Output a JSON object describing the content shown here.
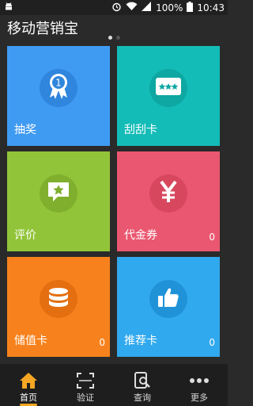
{
  "status_bar": {
    "battery_percent": "100%",
    "time": "10:43",
    "icons": [
      "android-icon",
      "alarm-icon",
      "wifi-icon",
      "signal-icon",
      "battery-icon"
    ]
  },
  "app": {
    "title": "移动营销宝"
  },
  "pager": {
    "total": 2,
    "current": 1
  },
  "tiles": [
    {
      "label": "抽奖",
      "count": "",
      "color": "#3f9bf2",
      "circle": "#2f86dc",
      "icon": "award-icon"
    },
    {
      "label": "刮刮卡",
      "count": "",
      "color": "#14bcb7",
      "circle": "#0ea7a2",
      "icon": "scratch-card-icon"
    },
    {
      "label": "评价",
      "count": "",
      "color": "#92c439",
      "circle": "#7faf2d",
      "icon": "review-star-icon"
    },
    {
      "label": "代金券",
      "count": "0",
      "color": "#ea5770",
      "circle": "#d7485f",
      "icon": "yen-coupon-icon"
    },
    {
      "label": "储值卡",
      "count": "0",
      "color": "#f7821d",
      "circle": "#e36f10",
      "icon": "coin-stack-icon"
    },
    {
      "label": "推荐卡",
      "count": "0",
      "color": "#31a9ee",
      "circle": "#2093d8",
      "icon": "thumbs-up-icon"
    }
  ],
  "nav": [
    {
      "label": "首页",
      "icon": "home-icon",
      "active": true
    },
    {
      "label": "验证",
      "icon": "scan-icon",
      "active": false
    },
    {
      "label": "查询",
      "icon": "search-doc-icon",
      "active": false
    },
    {
      "label": "更多",
      "icon": "more-icon",
      "active": false
    }
  ],
  "colors": {
    "background": "#2a2a2a",
    "nav_background": "#1e1e1e",
    "accent": "#f5a623"
  }
}
